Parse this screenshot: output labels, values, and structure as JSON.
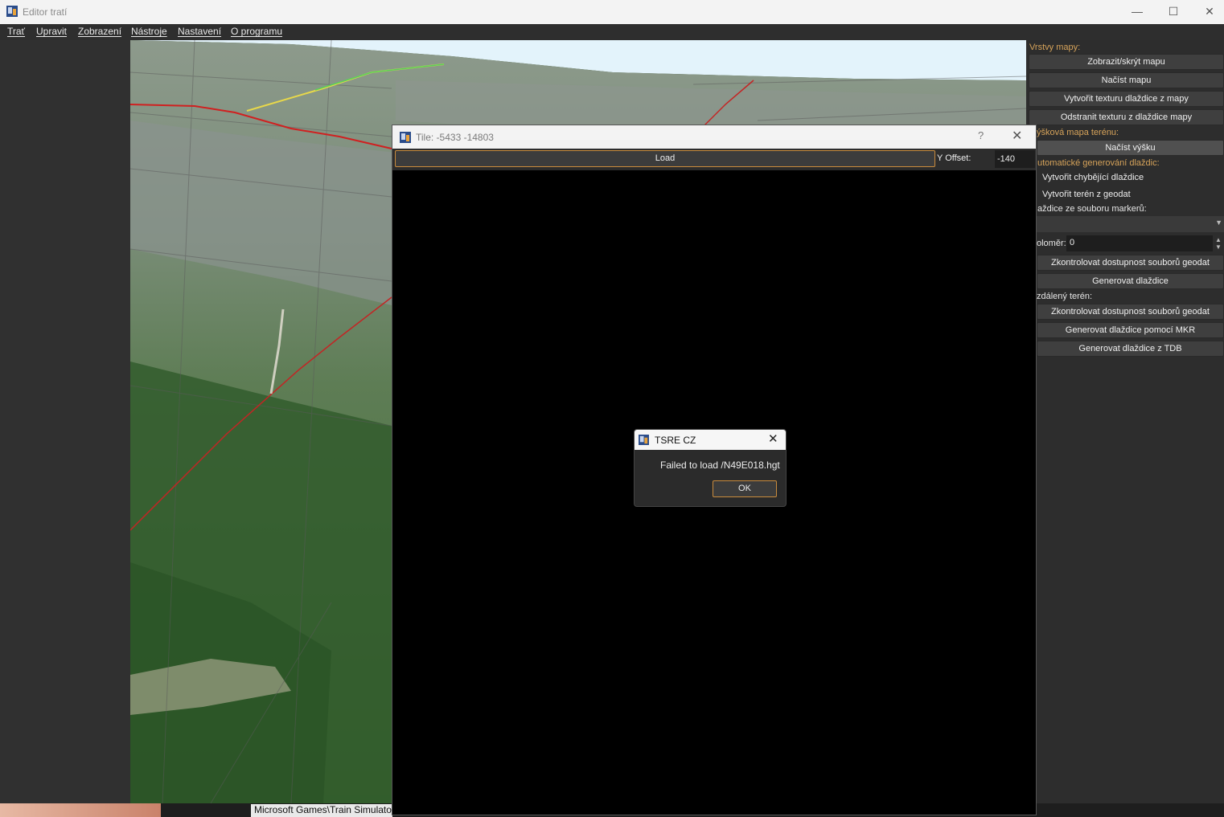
{
  "window": {
    "title": "Editor tratí"
  },
  "menu": [
    "Trať",
    "Upravit",
    "Zobrazení",
    "Nástroje",
    "Nastavení",
    "O programu"
  ],
  "right_panel": {
    "map_layers_label": "Vrstvy mapy:",
    "btn_toggle_map": "Zobrazit/skrýt mapu",
    "btn_load_map": "Načíst mapu",
    "btn_create_texture": "Vytvořit texturu dlaždice z mapy",
    "btn_remove_texture": "Odstranit texturu z dlaždice mapy",
    "heightmap_label": "ýšková mapa terénu:",
    "btn_load_height": "Načíst výšku",
    "auto_gen_label": "utomatické generování dlaždic:",
    "chk_missing_tiles": "Vytvořit chybějící dlaždice",
    "chk_terrain_geodata": "Vytvořit terén z geodat",
    "marker_file_label": "aždice ze souboru markerů:",
    "radius_label": "oloměr:",
    "radius_value": "0",
    "btn_check_geodata": "Zkontrolovat dostupnost souborů geodat",
    "btn_generate_tiles": "Generovat dlaždice",
    "distant_terrain_label": "zdálený terén:",
    "btn_check_geodata_2": "Zkontrolovat dostupnost souborů geodat",
    "btn_generate_mkr": "Generovat dlaždice pomocí MKR",
    "btn_generate_tdb": "Generovat dlaždice z TDB"
  },
  "tile_dialog": {
    "title": "Tile: -5433 -14803",
    "help": "?",
    "load_label": "Load",
    "y_offset_label": "Y Offset:",
    "y_offset_value": "-140"
  },
  "message_box": {
    "title": "TSRE CZ",
    "message": "Failed to load /N49E018.hgt",
    "ok_label": "OK"
  },
  "taskbar": {
    "path_text": "Microsoft Games\\Train Simulato"
  },
  "colors": {
    "accent": "#c98b3c",
    "label_orange": "#d6a35a"
  }
}
